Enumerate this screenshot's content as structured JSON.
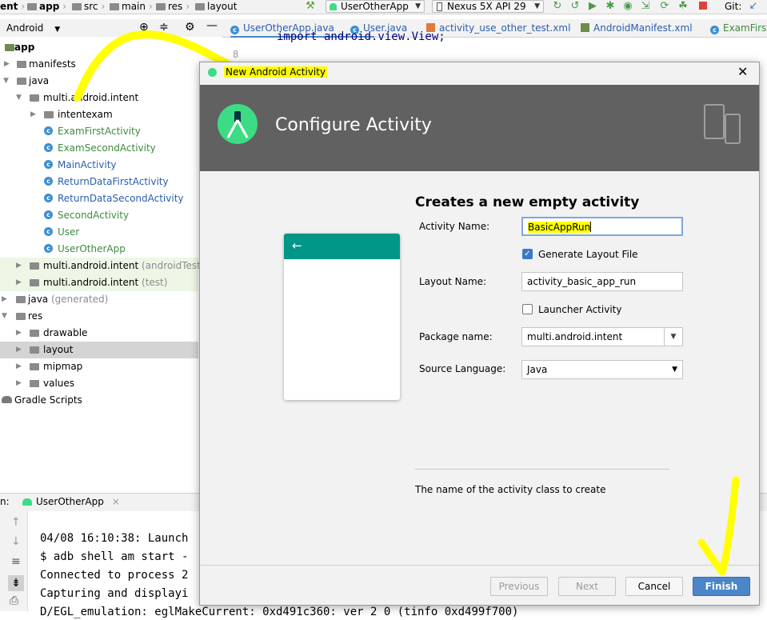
{
  "navbar": {
    "crumbs": [
      "ent",
      "app",
      "src",
      "main",
      "res",
      "layout"
    ],
    "run_config": "UserOtherApp",
    "device": "Nexus 5X API 29",
    "git_label": "Git:"
  },
  "project_panel": {
    "view_selector": "Android"
  },
  "tree": {
    "app": "app",
    "manifests": "manifests",
    "java": "java",
    "pkg_main": "multi.android.intent",
    "intentexam": "intentexam",
    "classes": [
      "ExamFirstActivity",
      "ExamSecondActivity",
      "MainActivity",
      "ReturnDataFirstActivity",
      "ReturnDataSecondActivity",
      "SecondActivity",
      "User",
      "UserOtherApp"
    ],
    "pkg_android_test": "multi.android.intent",
    "pkg_android_test_note": "(androidTest)",
    "pkg_test": "multi.android.intent",
    "pkg_test_note": "(test)",
    "java_generated": "java",
    "java_generated_note": "(generated)",
    "res": "res",
    "drawable": "drawable",
    "layout": "layout",
    "mipmap": "mipmap",
    "values": "values",
    "gradle": "Gradle Scripts"
  },
  "tabs": [
    {
      "label": "UserOtherApp.java",
      "active": true
    },
    {
      "label": "User.java"
    },
    {
      "label": "activity_use_other_test.xml"
    },
    {
      "label": "AndroidManifest.xml"
    },
    {
      "label": "ExamFirstA"
    }
  ],
  "editor": {
    "code_line": "import android.view.View;",
    "line_number": "8"
  },
  "run_panel": {
    "label": "n:",
    "config": "UserOtherApp",
    "lines": [
      "04/08 16:10:38: Launch",
      "$ adb shell am start -",
      "Connected to process 2",
      "Capturing and displayi",
      "D/EGL_emulation: eglMakeCurrent: 0xd491c360: ver 2 0 (tinfo 0xd499f700)"
    ]
  },
  "dialog": {
    "window_title": "New Android Activity",
    "banner_title": "Configure Activity",
    "heading": "Creates a new empty activity",
    "activity_name_label": "Activity Name:",
    "activity_name_value": "BasicAppRun",
    "generate_layout_label": "Generate Layout File",
    "generate_layout_checked": true,
    "layout_name_label": "Layout Name:",
    "layout_name_value": "activity_basic_app_run",
    "launcher_label": "Launcher Activity",
    "launcher_checked": false,
    "package_label": "Package name:",
    "package_value": "multi.android.intent",
    "language_label": "Source Language:",
    "language_value": "Java",
    "hint": "The name of the activity class to create",
    "buttons": {
      "previous": "Previous",
      "next": "Next",
      "cancel": "Cancel",
      "finish": "Finish"
    }
  },
  "colors": {
    "banner": "#616161",
    "preview_appbar": "#009688",
    "android_green": "#3ddc84",
    "highlight": "#ffff00",
    "finish_button": "#4a86c8"
  }
}
